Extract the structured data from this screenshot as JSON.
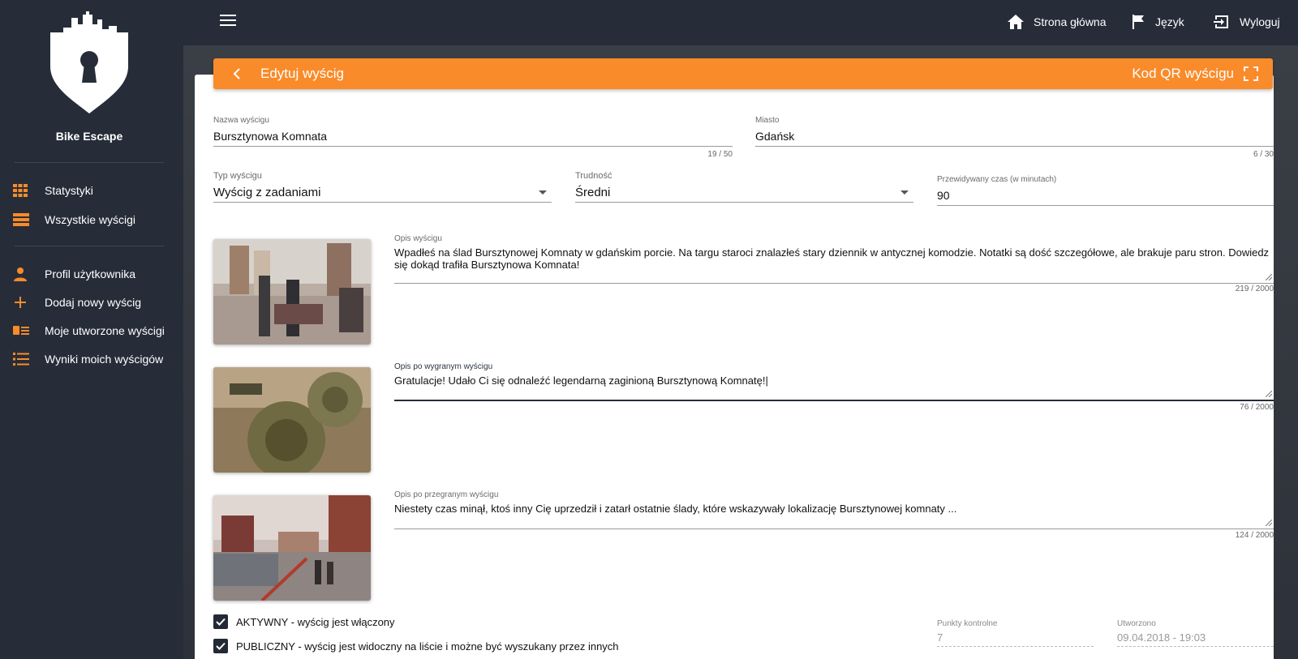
{
  "app": {
    "name": "Bike Escape"
  },
  "sidebar": {
    "items": [
      {
        "label": "Statystyki"
      },
      {
        "label": "Wszystkie wyścigi"
      },
      {
        "label": "Profil użytkownika"
      },
      {
        "label": "Dodaj nowy wyścig"
      },
      {
        "label": "Moje utworzone wyścigi"
      },
      {
        "label": "Wyniki moich wyścigów"
      }
    ]
  },
  "topbar": {
    "home": "Strona główna",
    "language": "Język",
    "logout": "Wyloguj"
  },
  "header": {
    "title": "Edytuj wyścig",
    "qr": "Kod QR wyścigu"
  },
  "form": {
    "name": {
      "label": "Nazwa wyścigu",
      "value": "Bursztynowa Komnata",
      "counter": "19 / 50"
    },
    "city": {
      "label": "Miasto",
      "value": "Gdańsk",
      "counter": "6 / 30"
    },
    "type": {
      "label": "Typ wyścigu",
      "value": "Wyścig z zadaniami"
    },
    "difficulty": {
      "label": "Trudność",
      "value": "Średni"
    },
    "time": {
      "label": "Przewidywany czas (w minutach)",
      "value": "90"
    },
    "desc": {
      "label": "Opis wyścigu",
      "value": "Wpadłeś na ślad Bursztynowej Komnaty w gdańskim porcie. Na targu staroci znalazłeś stary dziennik w antycznej komodzie. Notatki są dość szczegółowe, ale brakuje paru stron. Dowiedz się dokąd trafiła Bursztynowa Komnata!",
      "counter": "219 / 2000"
    },
    "win": {
      "label": "Opis po wygranym wyścigu",
      "value": "Gratulacje! Udało Ci się odnaleźć legendarną zaginioną Bursztynową Komnatę!",
      "counter": "76 / 2000"
    },
    "lose": {
      "label": "Opis po przegranym wyścigu",
      "value": "Niestety czas minął, ktoś inny Cię uprzedził i zatarł ostatnie ślady, które wskazywały lokalizację Bursztynowej komnaty ...",
      "counter": "124 / 2000"
    },
    "active": "AKTYWNY - wyścig jest włączony",
    "public": "PUBLICZNY - wyścig jest widoczny na liście i możne być wyszukany przez innych",
    "checkpoints": {
      "label": "Punkty kontrolne",
      "value": "7"
    },
    "created": {
      "label": "Utworzono",
      "value": "09.04.2018 - 19:03"
    }
  },
  "colors": {
    "accent": "#f98b2a",
    "sidebar": "#262d39"
  }
}
